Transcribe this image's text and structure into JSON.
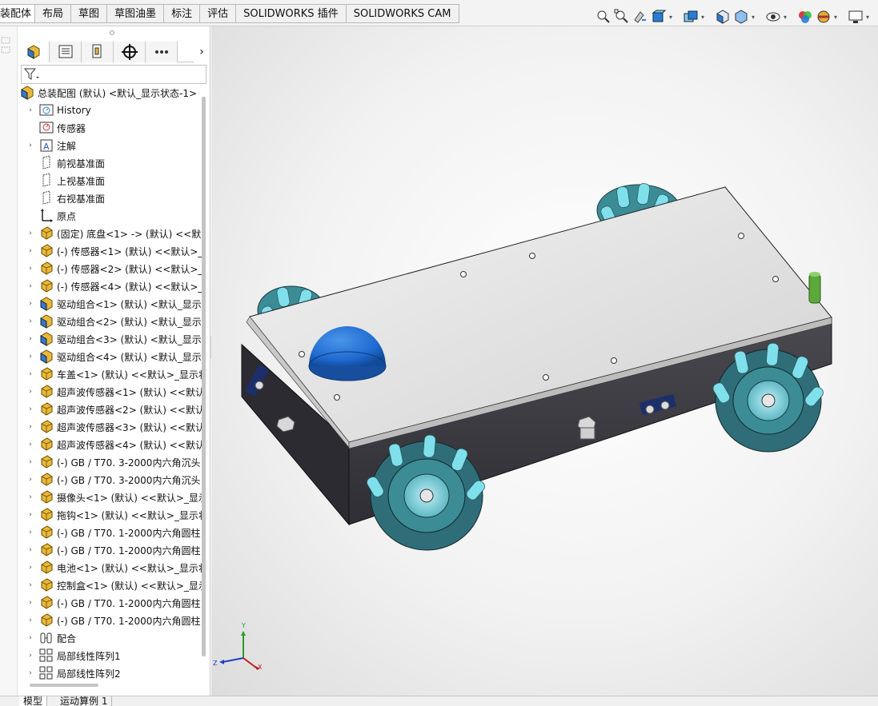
{
  "tabs": [
    "装配体",
    "布局",
    "草图",
    "草图油墨",
    "标注",
    "评估",
    "SOLIDWORKS 插件",
    "SOLIDWORKS CAM"
  ],
  "toolbar_icons": [
    "zoom-to-fit-icon",
    "zoom-area-icon",
    "previous-view-icon",
    "section-view-icon",
    "dynamic-annotation-icon",
    "view-orientation-icon",
    "display-style-icon",
    "hide-show-icon",
    "edit-appearance-icon",
    "apply-scene-icon",
    "view-settings-icon"
  ],
  "panel_tabs": [
    "featuremanager-tab",
    "propertymanager-tab",
    "configurationmanager-tab",
    "dimxpertmanager-tab",
    "more-tab"
  ],
  "tree": {
    "root": "总装配图 (默认) <默认_显示状态-1>",
    "items": [
      {
        "label": "History",
        "icon": "history",
        "exp": true
      },
      {
        "label": "传感器",
        "icon": "sensor",
        "exp": false
      },
      {
        "label": "注解",
        "icon": "annotation",
        "exp": true
      },
      {
        "label": "前视基准面",
        "icon": "plane",
        "exp": false
      },
      {
        "label": "上视基准面",
        "icon": "plane",
        "exp": false
      },
      {
        "label": "右视基准面",
        "icon": "plane",
        "exp": false
      },
      {
        "label": "原点",
        "icon": "origin",
        "exp": false
      },
      {
        "label": "(固定) 底盘<1> -> (默认) <<默",
        "icon": "part",
        "exp": true
      },
      {
        "label": "(-) 传感器<1> (默认) <<默认>_",
        "icon": "part",
        "exp": true
      },
      {
        "label": "(-) 传感器<2> (默认) <<默认>_",
        "icon": "part",
        "exp": true
      },
      {
        "label": "(-) 传感器<4> (默认) <<默认>_",
        "icon": "part",
        "exp": true
      },
      {
        "label": "驱动组合<1> (默认) <默认_显示",
        "icon": "assembly",
        "exp": true
      },
      {
        "label": "驱动组合<2> (默认) <默认_显示",
        "icon": "assembly",
        "exp": true
      },
      {
        "label": "驱动组合<3> (默认) <默认_显示",
        "icon": "assembly",
        "exp": true
      },
      {
        "label": "驱动组合<4> (默认) <默认_显示",
        "icon": "assembly",
        "exp": true
      },
      {
        "label": "车盖<1> (默认) <<默认>_显示状",
        "icon": "part",
        "exp": true
      },
      {
        "label": "超声波传感器<1> (默认) <<默认",
        "icon": "part",
        "exp": true
      },
      {
        "label": "超声波传感器<2> (默认) <<默认",
        "icon": "part",
        "exp": true
      },
      {
        "label": "超声波传感器<3> (默认) <<默认",
        "icon": "part",
        "exp": true
      },
      {
        "label": "超声波传感器<4> (默认) <<默认",
        "icon": "part",
        "exp": true
      },
      {
        "label": "(-) GB / T70. 3-2000内六角沉头",
        "icon": "part",
        "exp": true
      },
      {
        "label": "(-) GB / T70. 3-2000内六角沉头",
        "icon": "part",
        "exp": true
      },
      {
        "label": "摄像头<1> (默认) <<默认>_显示",
        "icon": "part",
        "exp": true
      },
      {
        "label": "拖钩<1> (默认) <<默认>_显示状",
        "icon": "part",
        "exp": true
      },
      {
        "label": "(-) GB / T70. 1-2000内六角圆柱",
        "icon": "part",
        "exp": true
      },
      {
        "label": "(-) GB / T70. 1-2000内六角圆柱",
        "icon": "part",
        "exp": true
      },
      {
        "label": "电池<1> (默认) <<默认>_显示状",
        "icon": "part",
        "exp": true
      },
      {
        "label": "控制盒<1> (默认) <<默认>_显示",
        "icon": "part",
        "exp": true
      },
      {
        "label": "(-) GB / T70. 1-2000内六角圆柱",
        "icon": "part",
        "exp": true
      },
      {
        "label": "(-) GB / T70. 1-2000内六角圆柱",
        "icon": "part",
        "exp": true
      },
      {
        "label": "配合",
        "icon": "mate",
        "exp": true
      },
      {
        "label": "局部线性阵列1",
        "icon": "pattern",
        "exp": true
      },
      {
        "label": "局部线性阵列2",
        "icon": "pattern",
        "exp": true
      }
    ]
  },
  "bottom_tabs": [
    "模型",
    "运动算例 1"
  ],
  "triad": {
    "x": "X",
    "y": "Y",
    "z": "Z"
  },
  "colors": {
    "part_yellow": "#e8b83a",
    "assembly_blue": "#3b77c8",
    "wheel_teal": "#3c8c96",
    "roller_cyan": "#7fe0ec",
    "body_dark": "#3d3c44",
    "lid_gray": "#dedede",
    "dome_blue": "#1f6ad0"
  }
}
